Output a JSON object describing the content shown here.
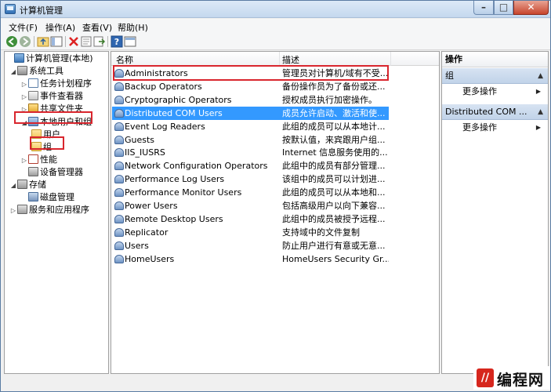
{
  "window": {
    "title": "计算机管理"
  },
  "menu": [
    "文件(F)",
    "操作(A)",
    "查看(V)",
    "帮助(H)"
  ],
  "toolbar": {
    "icons": [
      "back-icon",
      "forward-icon",
      "up-icon",
      "show-tree-icon",
      "delete-icon",
      "properties-icon",
      "export-icon",
      "help-icon",
      "console-icon"
    ]
  },
  "tree": {
    "root": "计算机管理(本地)",
    "system_tools": "系统工具",
    "task_scheduler": "任务计划程序",
    "event_viewer": "事件查看器",
    "shared_folders": "共享文件夹",
    "local_users": "本地用户和组",
    "users": "用户",
    "groups": "组",
    "performance": "性能",
    "device_manager": "设备管理器",
    "storage": "存储",
    "disk_management": "磁盘管理",
    "services_apps": "服务和应用程序"
  },
  "list": {
    "columns": {
      "name": "名称",
      "description": "描述"
    },
    "rows": [
      {
        "name": "Administrators",
        "desc": "管理员对计算机/域有不受..."
      },
      {
        "name": "Backup Operators",
        "desc": "备份操作员为了备份或还..."
      },
      {
        "name": "Cryptographic Operators",
        "desc": "授权成员执行加密操作。"
      },
      {
        "name": "Distributed COM Users",
        "desc": "成员允许启动、激活和使..."
      },
      {
        "name": "Event Log Readers",
        "desc": "此组的成员可以从本地计..."
      },
      {
        "name": "Guests",
        "desc": "按默认值，来宾跟用户组..."
      },
      {
        "name": "IIS_IUSRS",
        "desc": "Internet 信息服务使用的..."
      },
      {
        "name": "Network Configuration Operators",
        "desc": "此组中的成员有部分管理..."
      },
      {
        "name": "Performance Log Users",
        "desc": "该组中的成员可以计划进..."
      },
      {
        "name": "Performance Monitor Users",
        "desc": "此组的成员可以从本地和..."
      },
      {
        "name": "Power Users",
        "desc": "包括高级用户以向下兼容..."
      },
      {
        "name": "Remote Desktop Users",
        "desc": "此组中的成员被授予远程..."
      },
      {
        "name": "Replicator",
        "desc": "支持域中的文件复制"
      },
      {
        "name": "Users",
        "desc": "防止用户进行有意或无意..."
      },
      {
        "name": "HomeUsers",
        "desc": "HomeUsers Security Gr..."
      }
    ],
    "selected_index": 3
  },
  "actions": {
    "header": "操作",
    "section1": "组",
    "section1_more": "更多操作",
    "section2": "Distributed COM ...",
    "section2_more": "更多操作"
  },
  "watermark": {
    "text": "编程网"
  }
}
